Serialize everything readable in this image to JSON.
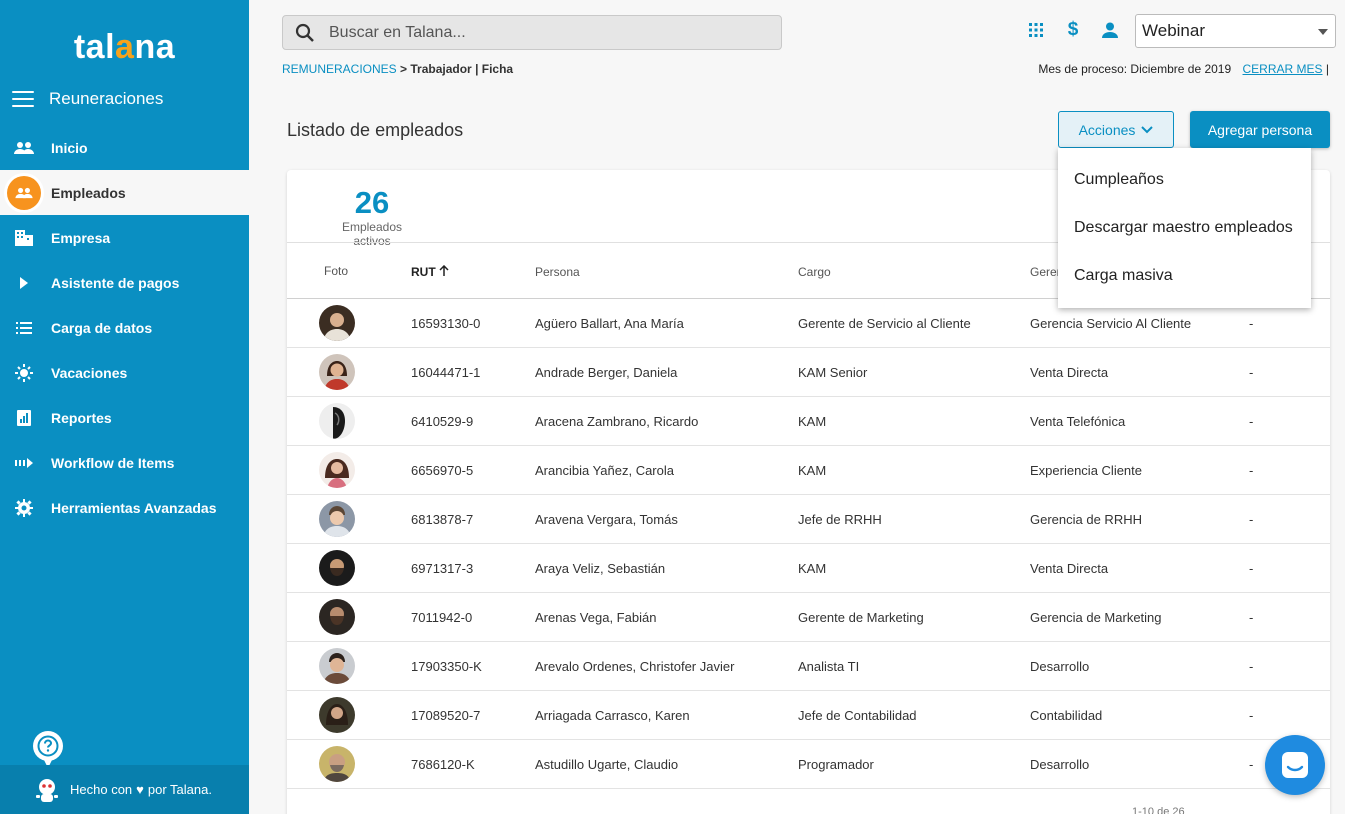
{
  "brand": {
    "logo_pre": "tal",
    "logo_accent": "a",
    "logo_post": "na",
    "accent_color": "#0a8fc2",
    "highlight_color": "#f7a21b"
  },
  "sidebar": {
    "module_title": "Reuneraciones",
    "items": [
      {
        "label": "Inicio",
        "icon": "people-icon",
        "active": false
      },
      {
        "label": "Empleados",
        "icon": "group-icon",
        "active": true
      },
      {
        "label": "Empresa",
        "icon": "building-icon",
        "active": false
      },
      {
        "label": "Asistente de pagos",
        "icon": "play-icon",
        "active": false
      },
      {
        "label": "Carga de datos",
        "icon": "list-icon",
        "active": false
      },
      {
        "label": "Vacaciones",
        "icon": "sun-icon",
        "active": false
      },
      {
        "label": "Reportes",
        "icon": "report-icon",
        "active": false
      },
      {
        "label": "Workflow de Items",
        "icon": "workflow-icon",
        "active": false
      },
      {
        "label": "Herramientas Avanzadas",
        "icon": "gear-icon",
        "active": false
      }
    ],
    "footer_pre": "Hecho con",
    "footer_post": "por Talana."
  },
  "topbar": {
    "search_placeholder": "Buscar en Talana...",
    "icons": [
      "apps-grid-icon",
      "dollar-icon",
      "user-icon"
    ],
    "company": "Webinar"
  },
  "breadcrumb": {
    "link": "REMUNERACIONES",
    "separator": " > ",
    "current": "Trabajador | Ficha"
  },
  "period": {
    "text": "Mes de proceso: Diciembre de 2019",
    "close_link": "CERRAR MES",
    "pipe": "|"
  },
  "page": {
    "title": "Listado de empleados",
    "actions_label": "Acciones",
    "add_label": "Agregar persona"
  },
  "stats": {
    "count": "26",
    "label": "Empleados activos"
  },
  "table": {
    "headers": {
      "foto": "Foto",
      "rut": "RUT",
      "persona": "Persona",
      "cargo": "Cargo",
      "gerencia": "Gerencia"
    },
    "rows": [
      {
        "rut": "16593130-0",
        "persona": "Agüero Ballart, Ana María",
        "cargo": "Gerente de Servicio al Cliente",
        "gerencia": "Gerencia Servicio Al Cliente",
        "extra": "-"
      },
      {
        "rut": "16044471-1",
        "persona": "Andrade Berger, Daniela",
        "cargo": "KAM Senior",
        "gerencia": "Venta Directa",
        "extra": "-"
      },
      {
        "rut": "6410529-9",
        "persona": "Aracena Zambrano, Ricardo",
        "cargo": "KAM",
        "gerencia": "Venta Telefónica",
        "extra": "-"
      },
      {
        "rut": "6656970-5",
        "persona": "Arancibia Yañez, Carola",
        "cargo": "KAM",
        "gerencia": "Experiencia Cliente",
        "extra": "-"
      },
      {
        "rut": "6813878-7",
        "persona": "Aravena Vergara, Tomás",
        "cargo": "Jefe de RRHH",
        "gerencia": "Gerencia de RRHH",
        "extra": "-"
      },
      {
        "rut": "6971317-3",
        "persona": "Araya Veliz, Sebastián",
        "cargo": "KAM",
        "gerencia": "Venta Directa",
        "extra": "-"
      },
      {
        "rut": "7011942-0",
        "persona": "Arenas Vega, Fabián",
        "cargo": "Gerente de Marketing",
        "gerencia": "Gerencia de Marketing",
        "extra": "-"
      },
      {
        "rut": "17903350-K",
        "persona": "Arevalo Ordenes, Christofer Javier",
        "cargo": "Analista TI",
        "gerencia": "Desarrollo",
        "extra": "-"
      },
      {
        "rut": "17089520-7",
        "persona": "Arriagada Carrasco, Karen",
        "cargo": "Jefe de Contabilidad",
        "gerencia": "Contabilidad",
        "extra": "-"
      },
      {
        "rut": "7686120-K",
        "persona": "Astudillo Ugarte, Claudio",
        "cargo": "Programador",
        "gerencia": "Desarrollo",
        "extra": "-"
      }
    ]
  },
  "pager": {
    "text": "1-10 de 26"
  },
  "actions_menu": {
    "items": [
      "Cumpleaños",
      "Descargar maestro empleados",
      "Carga masiva"
    ]
  }
}
